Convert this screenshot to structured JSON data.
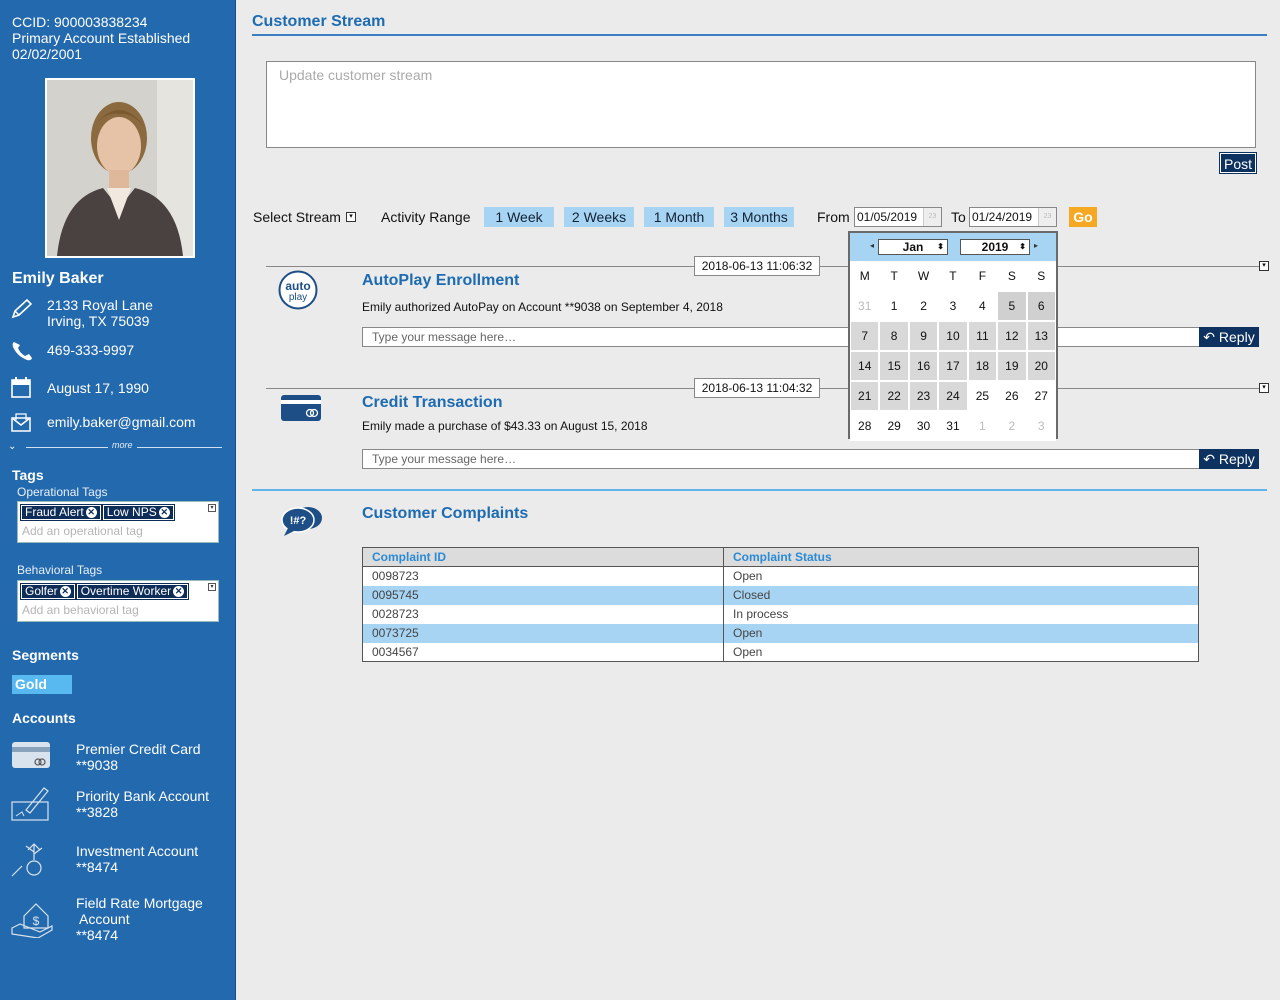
{
  "sidebar": {
    "ccid": "CCID: 900003838234",
    "account_established": "Primary Account Established",
    "established_date": "02/02/2001",
    "name": "Emily Baker",
    "address_line1": "2133 Royal Lane",
    "address_line2": "Irving, TX 75039",
    "phone": "469-333-9997",
    "birthday": "August 17, 1990",
    "email": "emily.baker@gmail.com",
    "more": "more",
    "tags_title": "Tags",
    "operational_title": "Operational Tags",
    "operational_tags": [
      "Fraud Alert",
      "Low NPS"
    ],
    "operational_placeholder": "Add an operational tag",
    "behavioral_title": "Behavioral Tags",
    "behavioral_tags": [
      "Golfer",
      "Overtime Worker"
    ],
    "behavioral_placeholder": "Add an behavioral tag",
    "segments_title": "Segments",
    "segment": "Gold",
    "accounts_title": "Accounts",
    "accounts": [
      {
        "name": "Premier Credit Card",
        "number": "**9038",
        "icon": "credit-card-icon"
      },
      {
        "name": "Priority Bank Account",
        "number": "**3828",
        "icon": "check-writing-icon"
      },
      {
        "name": "Investment Account",
        "number": "**8474",
        "icon": "investment-growth-icon"
      },
      {
        "name": "Field Rate Mortgage",
        "name2": "Account",
        "number": "**8474",
        "icon": "house-hand-icon"
      }
    ]
  },
  "main": {
    "title": "Customer Stream",
    "stream_placeholder": "Update customer stream",
    "post_label": "Post",
    "select_stream": "Select Stream",
    "activity_range": "Activity Range",
    "ranges": [
      "1 Week",
      "2 Weeks",
      "1 Month",
      "3 Months"
    ],
    "from_label": "From",
    "from_date": "01/05/2019",
    "to_label": "To",
    "to_date": "01/24/2019",
    "go_label": "Go",
    "feed": [
      {
        "timestamp": "2018-06-13 11:06:32",
        "title": "AutoPlay Enrollment",
        "body": "Emily authorized AutoPay on Account **9038 on September 4, 2018",
        "icon": "autoplay-icon",
        "icon_text1": "auto",
        "icon_text2": "play",
        "reply_placeholder": "Type your message here…",
        "reply_label": "Reply"
      },
      {
        "timestamp": "2018-06-13 11:04:32",
        "title": "Credit Transaction",
        "body": "Emily made a purchase of $43.33 on August 15, 2018",
        "icon": "credit-card-icon",
        "reply_placeholder": "Type your message here…",
        "reply_label": "Reply"
      }
    ],
    "complaints": {
      "title": "Customer Complaints",
      "icon": "speech-bubbles-icon",
      "icon_text": "!#?",
      "headers": [
        "Complaint ID",
        "Complaint Status"
      ],
      "rows": [
        [
          "0098723",
          "Open"
        ],
        [
          "0095745",
          "Closed"
        ],
        [
          "0028723",
          "In process"
        ],
        [
          "0073725",
          "Open"
        ],
        [
          "0034567",
          "Open"
        ]
      ]
    }
  },
  "datepicker": {
    "month": "Jan",
    "year": "2019",
    "weekdays": [
      "M",
      "T",
      "W",
      "T",
      "F",
      "S",
      "S"
    ],
    "weeks": [
      [
        "31",
        "1",
        "2",
        "3",
        "4",
        "5",
        "6"
      ],
      [
        "7",
        "8",
        "9",
        "10",
        "11",
        "12",
        "13"
      ],
      [
        "14",
        "15",
        "16",
        "17",
        "18",
        "19",
        "20"
      ],
      [
        "21",
        "22",
        "23",
        "24",
        "25",
        "26",
        "27"
      ],
      [
        "28",
        "29",
        "30",
        "31",
        "1",
        "2",
        "3"
      ]
    ]
  }
}
